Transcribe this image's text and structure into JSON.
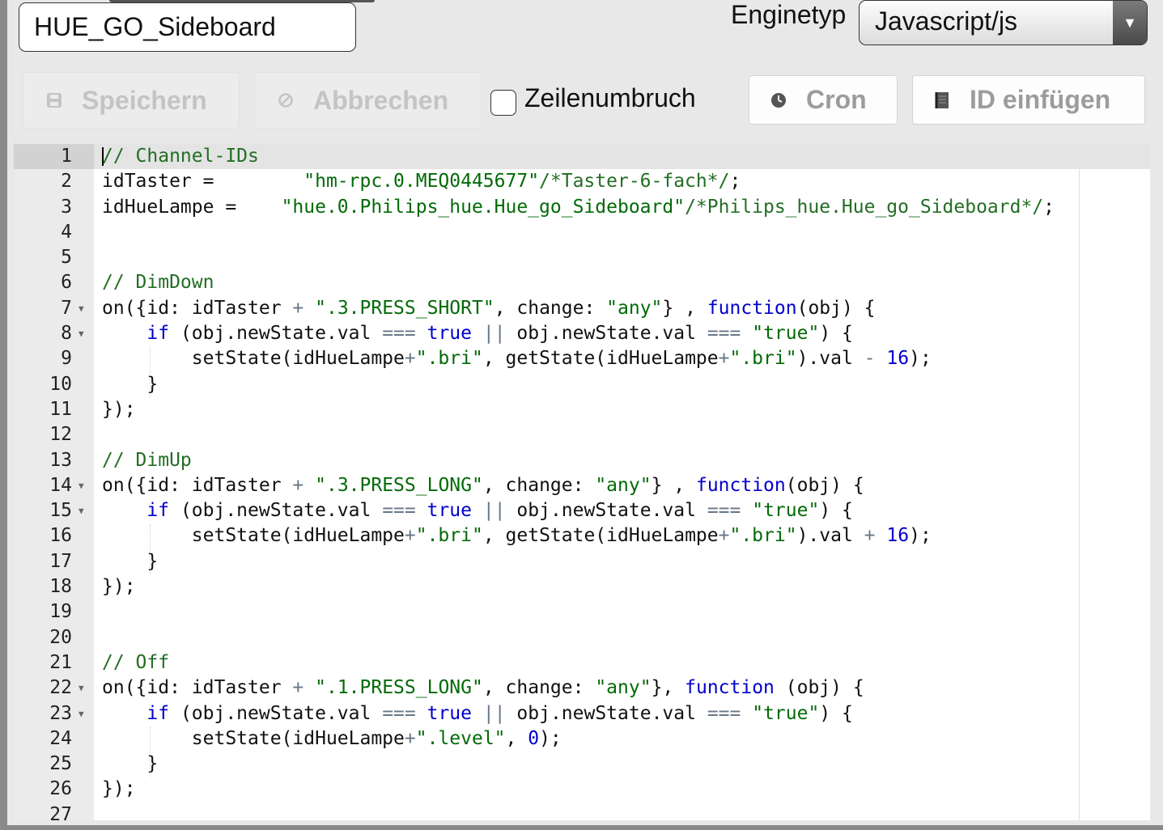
{
  "script_name": "HUE_GO_Sideboard",
  "engine": {
    "label": "Enginetyp",
    "value": "Javascript/js"
  },
  "toolbar": {
    "save": "Speichern",
    "cancel": "Abbrechen",
    "wrap": "Zeilenumbruch",
    "cron": "Cron",
    "insert_id": "ID einfügen"
  },
  "editor": {
    "active_line": 1,
    "lines": [
      [
        [
          "c",
          "// Channel-IDs"
        ]
      ],
      [
        [
          "t",
          "idTaster =        "
        ],
        [
          "s",
          "\"hm-rpc.0.MEQ0445677\""
        ],
        [
          "c",
          "/*Taster-6-fach*/"
        ],
        [
          "t",
          ";"
        ]
      ],
      [
        [
          "t",
          "idHueLampe =    "
        ],
        [
          "s",
          "\"hue.0.Philips_hue.Hue_go_Sideboard\""
        ],
        [
          "c",
          "/*Philips_hue.Hue_go_Sideboard*/"
        ],
        [
          "t",
          ";"
        ]
      ],
      [],
      [],
      [
        [
          "c",
          "// DimDown"
        ]
      ],
      [
        [
          "t",
          "on({id: idTaster "
        ],
        [
          "o",
          "+"
        ],
        [
          "t",
          " "
        ],
        [
          "s",
          "\".3.PRESS_SHORT\""
        ],
        [
          "t",
          ", change: "
        ],
        [
          "s",
          "\"any\""
        ],
        [
          "t",
          "} , "
        ],
        [
          "k",
          "function"
        ],
        [
          "t",
          "(obj) {"
        ]
      ],
      [
        [
          "t",
          "    "
        ],
        [
          "k",
          "if"
        ],
        [
          "t",
          " (obj.newState.val "
        ],
        [
          "o",
          "==="
        ],
        [
          "t",
          " "
        ],
        [
          "k",
          "true"
        ],
        [
          "t",
          " "
        ],
        [
          "o",
          "||"
        ],
        [
          "t",
          " obj.newState.val "
        ],
        [
          "o",
          "==="
        ],
        [
          "t",
          " "
        ],
        [
          "s",
          "\"true\""
        ],
        [
          "t",
          ") {"
        ]
      ],
      [
        [
          "t",
          "        setState(idHueLampe"
        ],
        [
          "o",
          "+"
        ],
        [
          "s",
          "\".bri\""
        ],
        [
          "t",
          ", getState(idHueLampe"
        ],
        [
          "o",
          "+"
        ],
        [
          "s",
          "\".bri\""
        ],
        [
          "t",
          ").val "
        ],
        [
          "o",
          "-"
        ],
        [
          "t",
          " "
        ],
        [
          "n",
          "16"
        ],
        [
          "t",
          ");"
        ]
      ],
      [
        [
          "t",
          "    }"
        ]
      ],
      [
        [
          "t",
          "});"
        ]
      ],
      [],
      [
        [
          "c",
          "// DimUp"
        ]
      ],
      [
        [
          "t",
          "on({id: idTaster "
        ],
        [
          "o",
          "+"
        ],
        [
          "t",
          " "
        ],
        [
          "s",
          "\".3.PRESS_LONG\""
        ],
        [
          "t",
          ", change: "
        ],
        [
          "s",
          "\"any\""
        ],
        [
          "t",
          "} , "
        ],
        [
          "k",
          "function"
        ],
        [
          "t",
          "(obj) {"
        ]
      ],
      [
        [
          "t",
          "    "
        ],
        [
          "k",
          "if"
        ],
        [
          "t",
          " (obj.newState.val "
        ],
        [
          "o",
          "==="
        ],
        [
          "t",
          " "
        ],
        [
          "k",
          "true"
        ],
        [
          "t",
          " "
        ],
        [
          "o",
          "||"
        ],
        [
          "t",
          " obj.newState.val "
        ],
        [
          "o",
          "==="
        ],
        [
          "t",
          " "
        ],
        [
          "s",
          "\"true\""
        ],
        [
          "t",
          ") {"
        ]
      ],
      [
        [
          "t",
          "        setState(idHueLampe"
        ],
        [
          "o",
          "+"
        ],
        [
          "s",
          "\".bri\""
        ],
        [
          "t",
          ", getState(idHueLampe"
        ],
        [
          "o",
          "+"
        ],
        [
          "s",
          "\".bri\""
        ],
        [
          "t",
          ").val "
        ],
        [
          "o",
          "+"
        ],
        [
          "t",
          " "
        ],
        [
          "n",
          "16"
        ],
        [
          "t",
          ");"
        ]
      ],
      [
        [
          "t",
          "    }"
        ]
      ],
      [
        [
          "t",
          "});"
        ]
      ],
      [],
      [],
      [
        [
          "c",
          "// Off"
        ]
      ],
      [
        [
          "t",
          "on({id: idTaster "
        ],
        [
          "o",
          "+"
        ],
        [
          "t",
          " "
        ],
        [
          "s",
          "\".1.PRESS_LONG\""
        ],
        [
          "t",
          ", change: "
        ],
        [
          "s",
          "\"any\""
        ],
        [
          "t",
          "}, "
        ],
        [
          "k",
          "function"
        ],
        [
          "t",
          " (obj) {"
        ]
      ],
      [
        [
          "t",
          "    "
        ],
        [
          "k",
          "if"
        ],
        [
          "t",
          " (obj.newState.val "
        ],
        [
          "o",
          "==="
        ],
        [
          "t",
          " "
        ],
        [
          "k",
          "true"
        ],
        [
          "t",
          " "
        ],
        [
          "o",
          "||"
        ],
        [
          "t",
          " obj.newState.val "
        ],
        [
          "o",
          "==="
        ],
        [
          "t",
          " "
        ],
        [
          "s",
          "\"true\""
        ],
        [
          "t",
          ") {"
        ]
      ],
      [
        [
          "t",
          "        setState(idHueLampe"
        ],
        [
          "o",
          "+"
        ],
        [
          "s",
          "\".level\""
        ],
        [
          "t",
          ", "
        ],
        [
          "n",
          "0"
        ],
        [
          "t",
          ");"
        ]
      ],
      [
        [
          "t",
          "    }"
        ]
      ],
      [
        [
          "t",
          "});"
        ]
      ],
      []
    ],
    "fold_lines": [
      7,
      8,
      14,
      15,
      22,
      23
    ]
  }
}
